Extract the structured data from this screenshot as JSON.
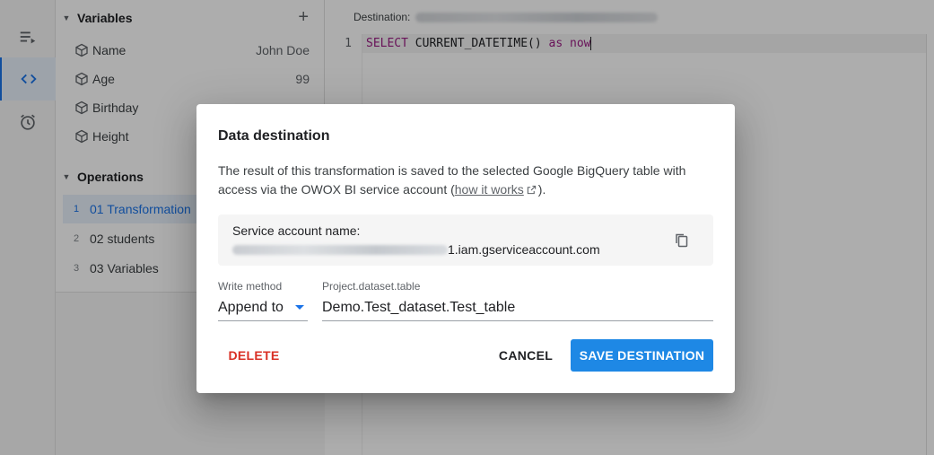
{
  "sidebar_panel": {
    "variables_header": "Variables",
    "add_symbol": "+",
    "variables": [
      {
        "name": "Name",
        "value": "John Doe"
      },
      {
        "name": "Age",
        "value": "99"
      },
      {
        "name": "Birthday",
        "value": ""
      },
      {
        "name": "Height",
        "value": ""
      }
    ],
    "operations_header": "Operations",
    "operations": [
      {
        "num": "1",
        "label": "01 Transformation"
      },
      {
        "num": "2",
        "label": "02 students"
      },
      {
        "num": "3",
        "label": "03 Variables"
      }
    ]
  },
  "editor": {
    "destination_label": "Destination:",
    "line_number": "1",
    "code": {
      "kw1": "SELECT",
      "fn": " CURRENT_DATETIME() ",
      "kw2": "as",
      "alias": " now"
    }
  },
  "dialog": {
    "title": "Data destination",
    "description_part1": "The result of this transformation is saved to the selected Google BigQuery table with access via the OWOX BI service account (",
    "link_text": "how it works",
    "description_part2": ").",
    "service_account_label": "Service account name:",
    "service_account_suffix": "1.iam.gserviceaccount.com",
    "write_method_label": "Write method",
    "write_method_value": "Append to",
    "table_label": "Project.dataset.table",
    "table_value": "Demo.Test_dataset.Test_table",
    "delete_label": "DELETE",
    "cancel_label": "CANCEL",
    "save_label": "SAVE DESTINATION"
  },
  "colors": {
    "accent": "#1a73e8",
    "primary_button": "#1e88e5",
    "danger": "#d93025"
  }
}
